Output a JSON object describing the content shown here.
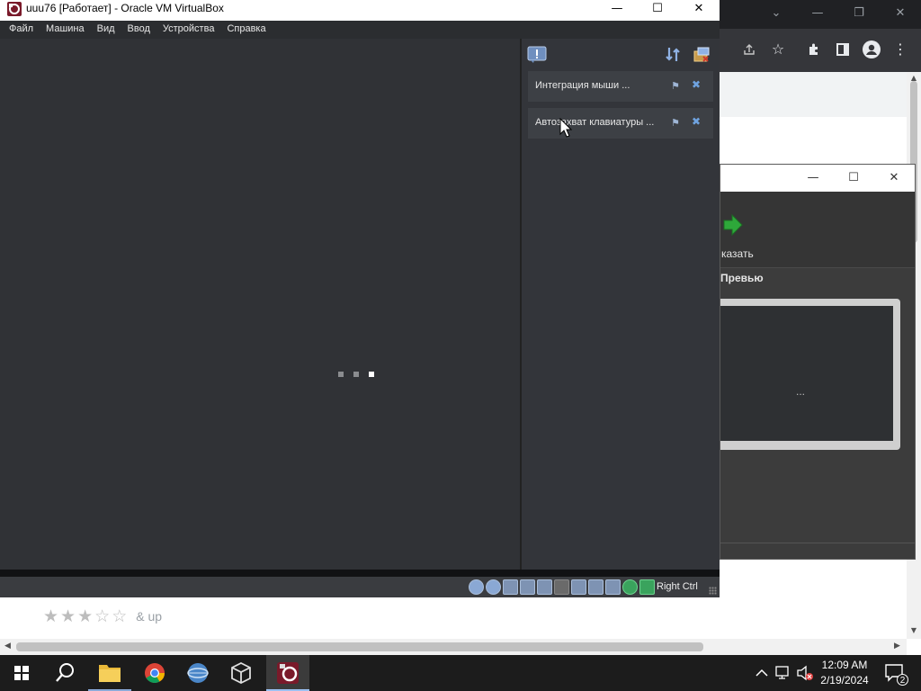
{
  "vbox": {
    "title": "uuu76 [Работает] - Oracle VM VirtualBox",
    "window_buttons": {
      "minimize": "—",
      "maximize": "☐",
      "close": "✕"
    },
    "menu": [
      "Файл",
      "Машина",
      "Вид",
      "Ввод",
      "Устройства",
      "Справка"
    ],
    "notifications": [
      {
        "text": "Интеграция мыши ...",
        "pin": "⚑",
        "close": "✖"
      },
      {
        "text": "Автозахват клавиатуры ...",
        "pin": "⚑",
        "close": "✖"
      }
    ],
    "status": {
      "host_key": "Right Ctrl"
    },
    "colors": {
      "screen": "#303236",
      "panel": "#33353a"
    }
  },
  "manager": {
    "window_buttons": {
      "minimize": "—",
      "maximize": "☐",
      "close": "✕"
    },
    "show_label": "казать",
    "preview_label": "Превью",
    "preview_dots": "..."
  },
  "chrome": {
    "window_buttons": {
      "chevron": "⌄",
      "minimize": "—",
      "restore": "❐",
      "close": "✕"
    },
    "rating": {
      "stars_filled": 3,
      "stars_total": 5,
      "label": "& up"
    }
  },
  "taskbar": {
    "clock_time": "12:09 AM",
    "clock_date": "2/19/2024",
    "notification_count": "2"
  }
}
